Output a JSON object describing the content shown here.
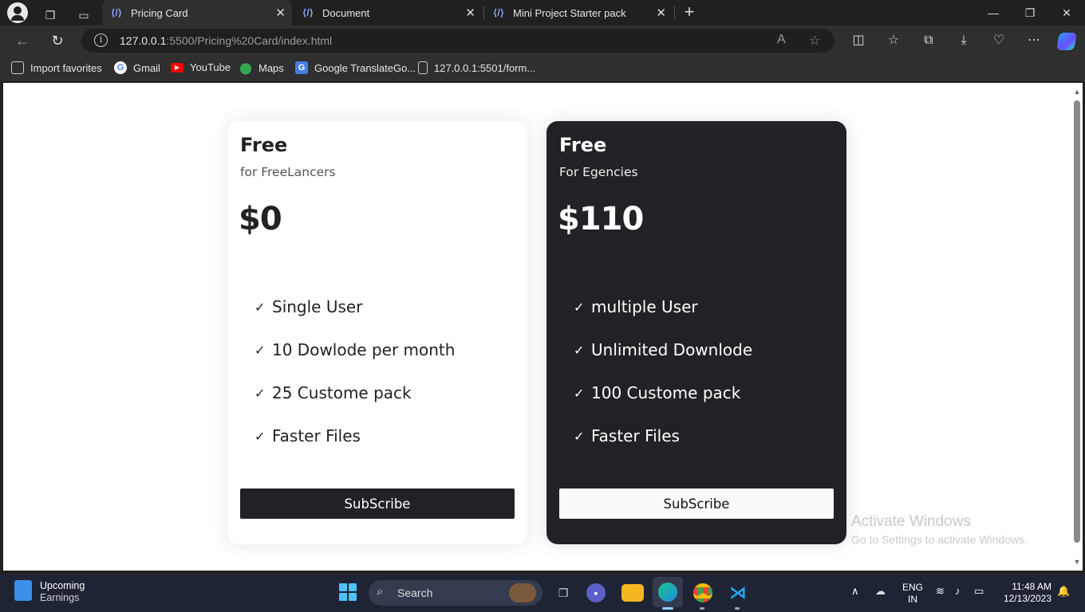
{
  "browser": {
    "tabs": [
      {
        "title": "Pricing Card",
        "active": true
      },
      {
        "title": "Document",
        "active": false
      },
      {
        "title": "Mini Project Starter pack",
        "active": false
      }
    ],
    "address": {
      "host": "127.0.0.1",
      "rest": ":5500/Pricing%20Card/index.html"
    },
    "favorites": [
      {
        "label": "Import favorites",
        "icon": "import-icon"
      },
      {
        "label": "Gmail",
        "icon": "google-icon"
      },
      {
        "label": "YouTube",
        "icon": "youtube-icon"
      },
      {
        "label": "Maps",
        "icon": "maps-icon"
      },
      {
        "label": "Google TranslateGo...",
        "icon": "translate-icon"
      },
      {
        "label": "127.0.0.1:5501/form...",
        "icon": "page-icon"
      }
    ]
  },
  "cards": [
    {
      "theme": "light",
      "plan": "Free",
      "subtitle": "for FreeLancers",
      "price": "$0",
      "features": [
        "Single User",
        "10 Dowlode per month",
        "25 Custome pack",
        "Faster Files"
      ],
      "button": "SubScribe"
    },
    {
      "theme": "dark",
      "plan": "Free",
      "subtitle": "For Egencies",
      "price": "$110",
      "features": [
        "multiple User",
        "Unlimited Downlode",
        "100 Custome pack",
        "Faster Files"
      ],
      "button": "SubScribe"
    }
  ],
  "watermark": {
    "title": "Activate Windows",
    "subtitle": "Go to Settings to activate Windows."
  },
  "taskbar": {
    "widget": {
      "title": "Upcoming",
      "subtitle": "Earnings"
    },
    "search_label": "Search",
    "lang": {
      "line1": "ENG",
      "line2": "IN"
    },
    "clock": {
      "time": "11:48 AM",
      "date": "12/13/2023"
    }
  },
  "colors": {
    "dark_card": "#212226",
    "accent_windows": "#4cc2ff",
    "browser_chrome": "#2f2f2f"
  }
}
